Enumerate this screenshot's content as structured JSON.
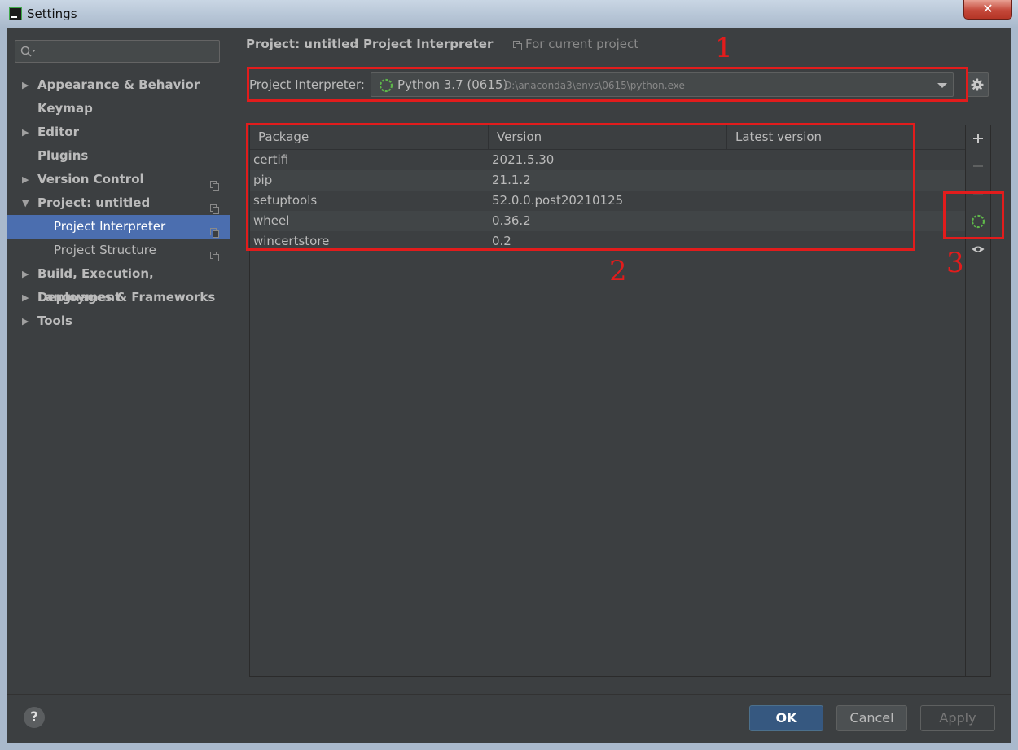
{
  "window": {
    "title": "Settings",
    "close_glyph": "✕"
  },
  "sidebar": {
    "search": {
      "value": "",
      "placeholder": ""
    },
    "items": [
      {
        "label": "Appearance & Behavior",
        "expandable": true,
        "expanded": false
      },
      {
        "label": "Keymap",
        "expandable": false
      },
      {
        "label": "Editor",
        "expandable": true,
        "expanded": false
      },
      {
        "label": "Plugins",
        "expandable": false
      },
      {
        "label": "Version Control",
        "expandable": true,
        "expanded": false,
        "project_scoped": true
      },
      {
        "label": "Project: untitled",
        "expandable": true,
        "expanded": true,
        "project_scoped": true
      },
      {
        "label": "Project Interpreter",
        "sub": true,
        "selected": true,
        "project_scoped": true
      },
      {
        "label": "Project Structure",
        "sub": true,
        "project_scoped": true
      },
      {
        "label": "Build, Execution, Deployment",
        "expandable": true,
        "expanded": false
      },
      {
        "label": "Languages & Frameworks",
        "expandable": true,
        "expanded": false
      },
      {
        "label": "Tools",
        "expandable": true,
        "expanded": false
      }
    ]
  },
  "breadcrumb": {
    "project": "Project: untitled",
    "separator": "›",
    "page": "Project Interpreter",
    "scope": "For current project"
  },
  "interpreter": {
    "label": "Project Interpreter:",
    "name": "Python 3.7 (0615)",
    "path": "D:\\anaconda3\\envs\\0615\\python.exe"
  },
  "packages": {
    "columns": [
      "Package",
      "Version",
      "Latest version"
    ],
    "rows": [
      {
        "package": "certifi",
        "version": "2021.5.30",
        "latest": ""
      },
      {
        "package": "pip",
        "version": "21.1.2",
        "latest": ""
      },
      {
        "package": "setuptools",
        "version": "52.0.0.post20210125",
        "latest": ""
      },
      {
        "package": "wheel",
        "version": "0.36.2",
        "latest": ""
      },
      {
        "package": "wincertstore",
        "version": "0.2",
        "latest": ""
      }
    ]
  },
  "toolbar": {
    "tools": [
      "add-icon",
      "remove-icon",
      "upgrade-icon",
      "loading-spinner-icon",
      "show-early-releases-icon"
    ]
  },
  "annotations": {
    "one": "1",
    "two": "2",
    "three": "3"
  },
  "buttons": {
    "help": "?",
    "ok": "OK",
    "cancel": "Cancel",
    "apply": "Apply"
  },
  "colors": {
    "background": "#3c3f41",
    "selection": "#4b6eaf",
    "primary_button": "#365880",
    "annotation_red": "#e21c1c",
    "spinner_green": "#5fb84a"
  }
}
